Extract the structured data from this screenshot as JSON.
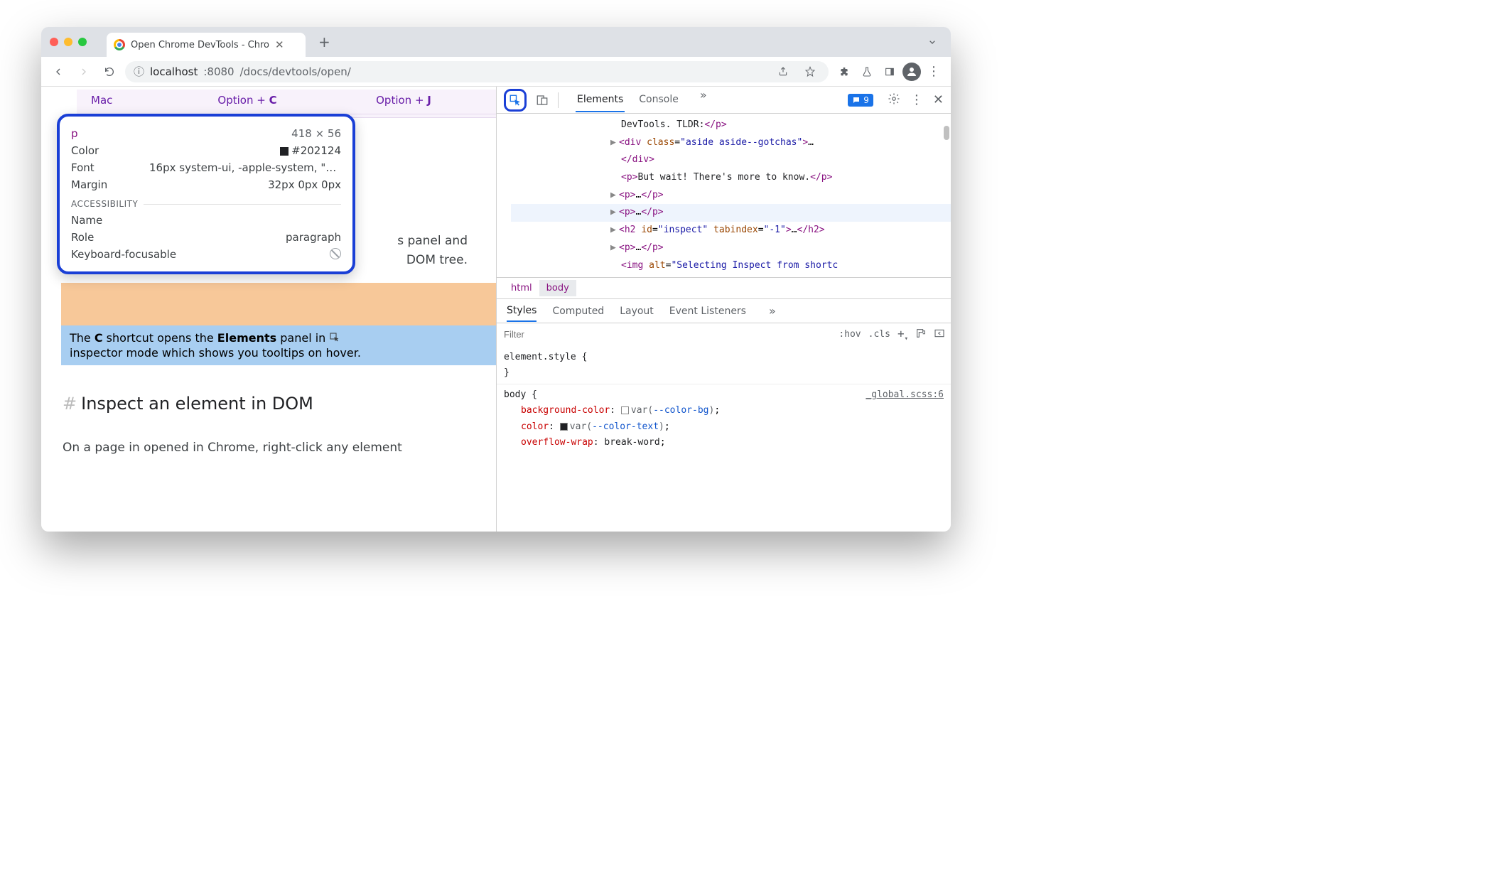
{
  "chrome": {
    "tab_title": "Open Chrome DevTools - Chro",
    "url_display_host": "localhost",
    "url_display_port": ":8080",
    "url_display_path": "/docs/devtools/open/"
  },
  "page": {
    "mac_label": "Mac",
    "option_c": "Option + ",
    "option_c_key": "C",
    "option_j": "Option + ",
    "option_j_key": "J",
    "tooltip": {
      "tag": "p",
      "dimensions": "418 × 56",
      "color_label": "Color",
      "color_value": "#202124",
      "font_label": "Font",
      "font_value": "16px system-ui, -apple-system, \"syste…",
      "margin_label": "Margin",
      "margin_value": "32px 0px 0px",
      "a11y_header": "ACCESSIBILITY",
      "name_label": "Name",
      "role_label": "Role",
      "role_value": "paragraph",
      "kbd_label": "Keyboard-focusable"
    },
    "visible_frag_1": "s panel and",
    "visible_frag_2": "DOM tree.",
    "highlight_line1_pre": "The ",
    "highlight_c": "C",
    "highlight_line1_mid": " shortcut opens the ",
    "highlight_elements": "Elements",
    "highlight_line1_post": " panel in ",
    "highlight_line2": "inspector mode which shows you tooltips on hover.",
    "heading": "Inspect an element in DOM",
    "body_text": "On a page in opened in Chrome, right-click any element"
  },
  "devtools": {
    "tabs": {
      "elements": "Elements",
      "console": "Console"
    },
    "issue_count": "9",
    "dom": {
      "line1_text": "DevTools. TLDR:",
      "line2_class": "aside aside--gotchas",
      "line3_text": "But wait! There's more to know.",
      "line6_id": "inspect",
      "line6_tabindex": "-1",
      "line8_alt": "Selecting Inspect from shortc"
    },
    "breadcrumb": {
      "html": "html",
      "body": "body"
    },
    "style_tabs": {
      "styles": "Styles",
      "computed": "Computed",
      "layout": "Layout",
      "listeners": "Event Listeners"
    },
    "filter_placeholder": "Filter",
    "hov": ":hov",
    "cls": ".cls",
    "styles": {
      "element_style": "element.style {",
      "body_sel": "body {",
      "src": "_global.scss:6",
      "bg_prop": "background-color",
      "bg_val_var": "--color-bg",
      "color_prop": "color",
      "color_val_var": "--color-text",
      "wrap_prop": "overflow-wrap",
      "wrap_val": "break-word"
    }
  }
}
